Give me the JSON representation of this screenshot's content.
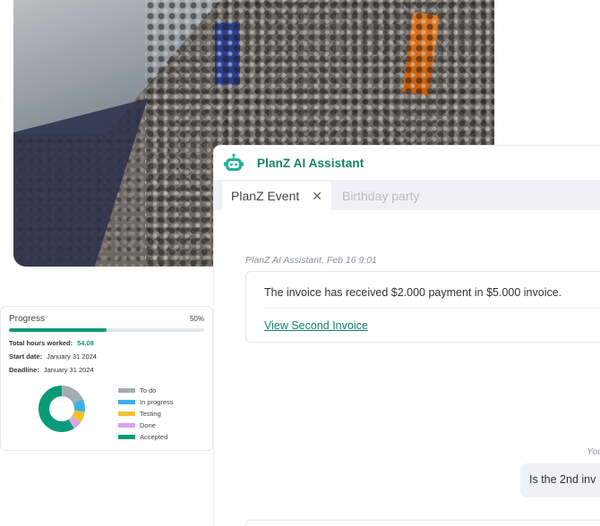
{
  "assistant": {
    "title": "PlanZ AI Assistant",
    "accent": "#13836a"
  },
  "tabs": [
    {
      "label": "PlanZ Event",
      "active": true
    },
    {
      "label": "Birthday party",
      "active": false
    }
  ],
  "messages": [
    {
      "meta": "PlanZ AI Assistant, Feb 16 9:01",
      "text": "The invoice has received $2.000 payment in $5.000 invoice.",
      "link": "View Second Invoice"
    },
    {
      "meta": "You",
      "text": "Is the 2nd inv"
    }
  ],
  "progress_card": {
    "title": "Progress",
    "percent_label": "50%",
    "progress": 0.5,
    "stats": [
      {
        "label": "Total hours worked:",
        "value": "54.08"
      },
      {
        "label": "Start date:",
        "value": "January 31 2024"
      },
      {
        "label": "Deadline:",
        "value": "January 31 2024"
      }
    ],
    "legend": [
      {
        "label": "To do",
        "color": "#a3aeb0",
        "share": 0.18
      },
      {
        "label": "In progress",
        "color": "#3fb0e6",
        "share": 0.09
      },
      {
        "label": "Testing",
        "color": "#f2c230",
        "share": 0.08
      },
      {
        "label": "Done",
        "color": "#d8a3ee",
        "share": 0.06
      },
      {
        "label": "Accepted",
        "color": "#0a9a78",
        "share": 0.59
      }
    ]
  }
}
